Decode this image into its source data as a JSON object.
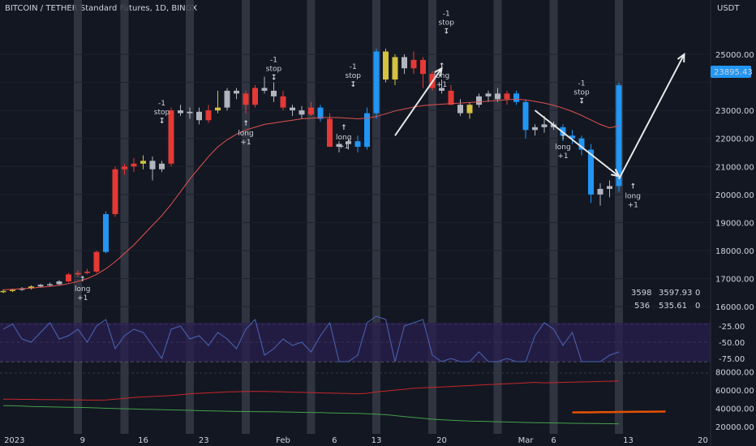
{
  "header": {
    "title": "BITCOIN / TETHER Standard Futures, 1D, BINGX"
  },
  "axis": {
    "currency": "USDT"
  },
  "last_price": {
    "value": "23895.43",
    "color": "#2196f3"
  },
  "price_axis_labels": [
    "25000.00",
    "23000.00",
    "22000.00",
    "21000.00",
    "20000.00",
    "19000.00",
    "18000.00",
    "17000.00",
    "16000.00"
  ],
  "indicator_axis_labels": [
    "-25.00",
    "-50.00",
    "-75.00"
  ],
  "volume_axis_labels": [
    "80000.00",
    "60000.00",
    "40000.00",
    "20000.00"
  ],
  "x_axis_labels": [
    "2023",
    "9",
    "16",
    "23",
    "Feb",
    "6",
    "13",
    "20",
    "Mar",
    "6",
    "13",
    "20"
  ],
  "readouts": {
    "line1_a": "3598",
    "line1_b": "3597.93",
    "line1_c": "0",
    "line2_a": "536",
    "line2_b": "535.61",
    "line2_c": "0"
  },
  "signals": [
    {
      "kind": "long",
      "label": "long",
      "sub": "+1"
    },
    {
      "kind": "stop",
      "label": "-1",
      "sub": "stop"
    }
  ],
  "colors": {
    "up": "#2196f3",
    "down": "#e53935",
    "neutral": "#b2b5be",
    "yellow": "#d4c240",
    "ma": "#e0524f",
    "stop": "#e040fb"
  },
  "chart_data": {
    "type": "candlestick",
    "y_range": [
      15600,
      26300
    ],
    "candles": [
      {
        "o": 16530,
        "h": 16620,
        "l": 16480,
        "c": 16560,
        "col": "yellow"
      },
      {
        "o": 16560,
        "h": 16640,
        "l": 16520,
        "c": 16600,
        "col": "yellow"
      },
      {
        "o": 16600,
        "h": 16700,
        "l": 16560,
        "c": 16650,
        "col": "neutral"
      },
      {
        "o": 16650,
        "h": 16760,
        "l": 16610,
        "c": 16720,
        "col": "yellow"
      },
      {
        "o": 16720,
        "h": 16820,
        "l": 16680,
        "c": 16780,
        "col": "neutral"
      },
      {
        "o": 16780,
        "h": 16860,
        "l": 16720,
        "c": 16800,
        "col": "neutral"
      },
      {
        "o": 16800,
        "h": 16950,
        "l": 16760,
        "c": 16900,
        "col": "neutral"
      },
      {
        "o": 16900,
        "h": 17200,
        "l": 16860,
        "c": 17150,
        "col": "down"
      },
      {
        "o": 17150,
        "h": 17300,
        "l": 17080,
        "c": 17200,
        "col": "down"
      },
      {
        "o": 17200,
        "h": 17350,
        "l": 17150,
        "c": 17250,
        "col": "down"
      },
      {
        "o": 17250,
        "h": 18000,
        "l": 17200,
        "c": 17950,
        "col": "down"
      },
      {
        "o": 17950,
        "h": 19400,
        "l": 17900,
        "c": 19300,
        "col": "up"
      },
      {
        "o": 19300,
        "h": 21000,
        "l": 19200,
        "c": 20900,
        "col": "down"
      },
      {
        "o": 20900,
        "h": 21100,
        "l": 20700,
        "c": 21000,
        "col": "down"
      },
      {
        "o": 21000,
        "h": 21300,
        "l": 20800,
        "c": 21100,
        "col": "down"
      },
      {
        "o": 21100,
        "h": 21400,
        "l": 20900,
        "c": 21200,
        "col": "yellow"
      },
      {
        "o": 21200,
        "h": 21350,
        "l": 20500,
        "c": 20900,
        "col": "neutral"
      },
      {
        "o": 20900,
        "h": 21200,
        "l": 20800,
        "c": 21100,
        "col": "neutral"
      },
      {
        "o": 21100,
        "h": 23100,
        "l": 21000,
        "c": 23000,
        "col": "down"
      },
      {
        "o": 23000,
        "h": 23200,
        "l": 22800,
        "c": 22900,
        "col": "neutral"
      },
      {
        "o": 22900,
        "h": 23100,
        "l": 22700,
        "c": 22950,
        "col": "neutral"
      },
      {
        "o": 22950,
        "h": 23100,
        "l": 22500,
        "c": 22650,
        "col": "neutral"
      },
      {
        "o": 22650,
        "h": 23200,
        "l": 22550,
        "c": 23000,
        "col": "down"
      },
      {
        "o": 23000,
        "h": 23700,
        "l": 22900,
        "c": 23100,
        "col": "yellow"
      },
      {
        "o": 23100,
        "h": 23800,
        "l": 23000,
        "c": 23700,
        "col": "neutral"
      },
      {
        "o": 23700,
        "h": 23800,
        "l": 23400,
        "c": 23600,
        "col": "neutral"
      },
      {
        "o": 23600,
        "h": 23700,
        "l": 22900,
        "c": 23200,
        "col": "down"
      },
      {
        "o": 23200,
        "h": 23900,
        "l": 23100,
        "c": 23800,
        "col": "down"
      },
      {
        "o": 23800,
        "h": 24200,
        "l": 23600,
        "c": 23700,
        "col": "neutral"
      },
      {
        "o": 23700,
        "h": 24000,
        "l": 23300,
        "c": 23500,
        "col": "neutral"
      },
      {
        "o": 23500,
        "h": 23700,
        "l": 23000,
        "c": 23100,
        "col": "down"
      },
      {
        "o": 23100,
        "h": 23200,
        "l": 22800,
        "c": 23000,
        "col": "neutral"
      },
      {
        "o": 23000,
        "h": 23150,
        "l": 22700,
        "c": 22850,
        "col": "neutral"
      },
      {
        "o": 22850,
        "h": 23300,
        "l": 22800,
        "c": 23100,
        "col": "down"
      },
      {
        "o": 23100,
        "h": 23200,
        "l": 22600,
        "c": 22700,
        "col": "up"
      },
      {
        "o": 22700,
        "h": 22900,
        "l": 21700,
        "c": 21700,
        "col": "down"
      },
      {
        "o": 21700,
        "h": 21900,
        "l": 21500,
        "c": 21800,
        "col": "neutral"
      },
      {
        "o": 21800,
        "h": 22000,
        "l": 21600,
        "c": 21900,
        "col": "neutral"
      },
      {
        "o": 21900,
        "h": 22100,
        "l": 21500,
        "c": 21700,
        "col": "up"
      },
      {
        "o": 21700,
        "h": 23100,
        "l": 21600,
        "c": 22900,
        "col": "up"
      },
      {
        "o": 22900,
        "h": 25200,
        "l": 22700,
        "c": 25100,
        "col": "up"
      },
      {
        "o": 25100,
        "h": 25200,
        "l": 24000,
        "c": 24100,
        "col": "yellow"
      },
      {
        "o": 24100,
        "h": 25000,
        "l": 23900,
        "c": 24900,
        "col": "yellow"
      },
      {
        "o": 24900,
        "h": 25000,
        "l": 24300,
        "c": 24500,
        "col": "neutral"
      },
      {
        "o": 24500,
        "h": 25100,
        "l": 24300,
        "c": 24800,
        "col": "down"
      },
      {
        "o": 24800,
        "h": 24900,
        "l": 23800,
        "c": 24300,
        "col": "down"
      },
      {
        "o": 24300,
        "h": 24400,
        "l": 23700,
        "c": 23800,
        "col": "down"
      },
      {
        "o": 23800,
        "h": 24100,
        "l": 23600,
        "c": 23700,
        "col": "neutral"
      },
      {
        "o": 23700,
        "h": 23900,
        "l": 23200,
        "c": 23200,
        "col": "down"
      },
      {
        "o": 23200,
        "h": 23400,
        "l": 22800,
        "c": 22900,
        "col": "neutral"
      },
      {
        "o": 22900,
        "h": 23300,
        "l": 22700,
        "c": 23200,
        "col": "yellow"
      },
      {
        "o": 23200,
        "h": 23600,
        "l": 23100,
        "c": 23500,
        "col": "neutral"
      },
      {
        "o": 23500,
        "h": 23700,
        "l": 23300,
        "c": 23600,
        "col": "neutral"
      },
      {
        "o": 23600,
        "h": 23800,
        "l": 23300,
        "c": 23400,
        "col": "neutral"
      },
      {
        "o": 23400,
        "h": 23700,
        "l": 23200,
        "c": 23600,
        "col": "down"
      },
      {
        "o": 23600,
        "h": 23700,
        "l": 23200,
        "c": 23300,
        "col": "up"
      },
      {
        "o": 23300,
        "h": 23400,
        "l": 22000,
        "c": 22300,
        "col": "up"
      },
      {
        "o": 22300,
        "h": 22500,
        "l": 22100,
        "c": 22400,
        "col": "neutral"
      },
      {
        "o": 22400,
        "h": 22800,
        "l": 22200,
        "c": 22500,
        "col": "neutral"
      },
      {
        "o": 22500,
        "h": 22600,
        "l": 22300,
        "c": 22400,
        "col": "neutral"
      },
      {
        "o": 22400,
        "h": 22500,
        "l": 21900,
        "c": 22100,
        "col": "up"
      },
      {
        "o": 22100,
        "h": 22300,
        "l": 21800,
        "c": 22000,
        "col": "up"
      },
      {
        "o": 22000,
        "h": 22100,
        "l": 21400,
        "c": 21600,
        "col": "up"
      },
      {
        "o": 21600,
        "h": 21800,
        "l": 19700,
        "c": 20000,
        "col": "up"
      },
      {
        "o": 20000,
        "h": 20400,
        "l": 19600,
        "c": 20200,
        "col": "neutral"
      },
      {
        "o": 20200,
        "h": 20500,
        "l": 19900,
        "c": 20300,
        "col": "neutral"
      },
      {
        "o": 20300,
        "h": 24000,
        "l": 20100,
        "c": 23895,
        "col": "up"
      }
    ],
    "ma_line": [
      16600,
      16620,
      16640,
      16660,
      16690,
      16720,
      16760,
      16820,
      16900,
      17000,
      17150,
      17350,
      17600,
      17900,
      18200,
      18550,
      18900,
      19250,
      19650,
      20100,
      20550,
      20950,
      21350,
      21700,
      21950,
      22150,
      22300,
      22400,
      22500,
      22550,
      22600,
      22650,
      22700,
      22720,
      22740,
      22750,
      22740,
      22720,
      22700,
      22720,
      22780,
      22880,
      22980,
      23050,
      23120,
      23170,
      23200,
      23220,
      23240,
      23260,
      23280,
      23300,
      23330,
      23360,
      23380,
      23400,
      23370,
      23320,
      23260,
      23180,
      23080,
      22960,
      22820,
      22660,
      22500,
      22380,
      22450
    ],
    "series": [
      {
        "name": "indicator",
        "values": [
          -30,
          -22,
          -45,
          -50,
          -35,
          -20,
          -45,
          -40,
          -30,
          -50,
          -25,
          -15,
          -60,
          -40,
          -30,
          -35,
          -55,
          -75,
          -30,
          -25,
          -45,
          -40,
          -55,
          -35,
          -45,
          -60,
          -30,
          -15,
          -70,
          -60,
          -45,
          -55,
          -50,
          -65,
          -40,
          -20,
          -80,
          -80,
          -70,
          -20,
          -10,
          -15,
          -80,
          -25,
          -20,
          -15,
          -70,
          -80,
          -75,
          -80,
          -80,
          -65,
          -80,
          -80,
          -75,
          -80,
          -80,
          -40,
          -20,
          -30,
          -55,
          -35,
          -80,
          -80,
          -80,
          -70,
          -65
        ]
      },
      {
        "name": "line-red",
        "values": [
          50000,
          50000,
          49800,
          49800,
          49600,
          49600,
          49500,
          49400,
          49300,
          49000,
          49000,
          49100,
          50000,
          51000,
          52000,
          52500,
          53000,
          53500,
          54000,
          55000,
          56000,
          56500,
          57000,
          57500,
          58000,
          58200,
          58500,
          58600,
          58500,
          58300,
          58000,
          57800,
          57500,
          57300,
          57000,
          56800,
          56500,
          56300,
          56000,
          56500,
          58000,
          59000,
          60000,
          61000,
          62000,
          62500,
          63000,
          63500,
          64000,
          64500,
          65000,
          65500,
          66000,
          66500,
          67000,
          67500,
          68000,
          68500,
          68000,
          68200,
          68500,
          68800,
          69000,
          69200,
          69500,
          69800,
          70000
        ]
      },
      {
        "name": "line-green",
        "values": [
          43000,
          42800,
          42500,
          42000,
          41800,
          41600,
          41400,
          41200,
          41000,
          40800,
          40500,
          40000,
          39800,
          39500,
          39200,
          39000,
          38800,
          38500,
          38300,
          38000,
          37800,
          37500,
          37300,
          37000,
          36800,
          36600,
          36500,
          36400,
          36300,
          36200,
          36000,
          35800,
          35600,
          35500,
          35300,
          35000,
          34800,
          34600,
          34400,
          34000,
          33500,
          33000,
          32000,
          31000,
          30000,
          29000,
          28000,
          27500,
          27000,
          26500,
          26000,
          25800,
          25500,
          25300,
          25000,
          24800,
          24500,
          24300,
          24100,
          24000,
          23800,
          23600,
          23500,
          23300,
          23200,
          23100,
          23000
        ]
      },
      {
        "name": "line-orange",
        "values": [
          35500,
          35700,
          35600,
          35800,
          35900,
          36000,
          36100,
          36200,
          36300,
          36400,
          36500
        ]
      }
    ]
  }
}
